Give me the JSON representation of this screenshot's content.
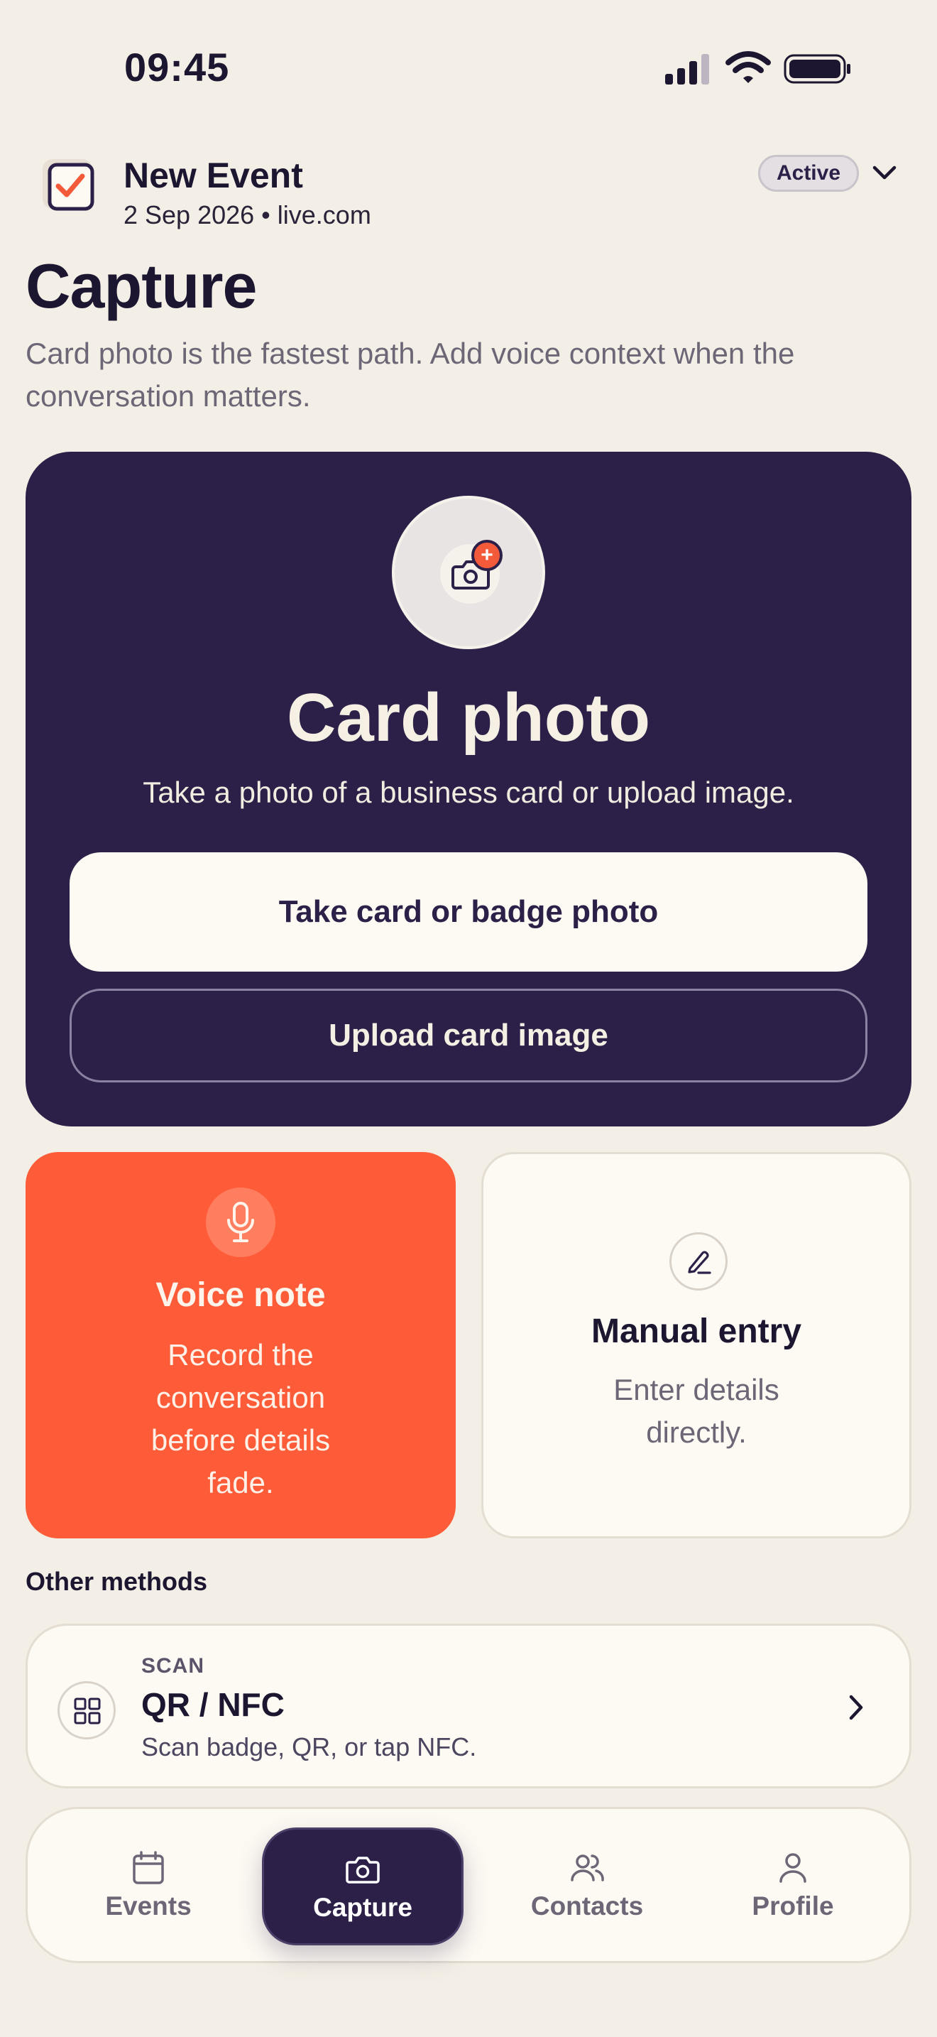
{
  "status_bar": {
    "time": "09:45"
  },
  "event": {
    "name": "New Event",
    "meta": "2 Sep 2026 • live.com",
    "status": "Active"
  },
  "page": {
    "title": "Capture",
    "subtitle": "Card photo is the fastest path. Add voice context when the conversation matters."
  },
  "card_photo": {
    "badge": "+",
    "title": "Card photo",
    "description": "Take a photo of a business card or upload image.",
    "primary_button": "Take card or badge photo",
    "secondary_button": "Upload card image"
  },
  "voice_note": {
    "title": "Voice note",
    "description": "Record the conversation before details fade."
  },
  "manual_entry": {
    "title": "Manual entry",
    "description": "Enter details directly."
  },
  "other_methods": {
    "heading": "Other methods",
    "items": [
      {
        "kicker": "SCAN",
        "title": "QR / NFC",
        "description": "Scan badge, QR, or tap NFC."
      }
    ]
  },
  "nav": {
    "items": [
      {
        "label": "Events",
        "icon": "calendar-icon"
      },
      {
        "label": "Capture",
        "icon": "camera-icon",
        "active": true
      },
      {
        "label": "Contacts",
        "icon": "people-icon"
      },
      {
        "label": "Profile",
        "icon": "person-icon"
      }
    ]
  },
  "colors": {
    "background": "#f3efe6",
    "brand_dark": "#2d2048",
    "accent": "#fe5c39",
    "card": "#fdfaf3"
  }
}
